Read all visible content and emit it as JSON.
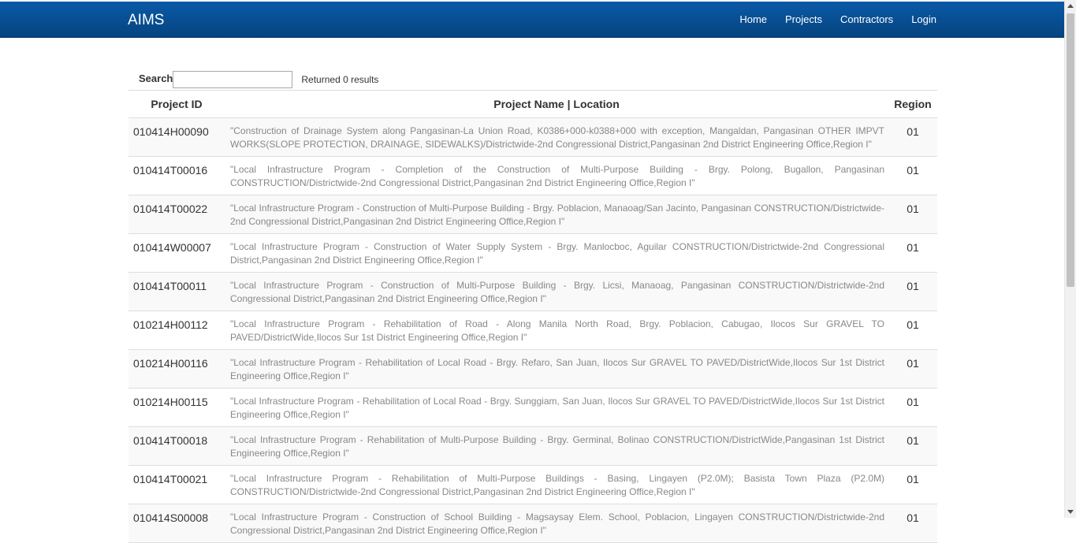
{
  "navbar": {
    "brand": "AIMS",
    "links": [
      "Home",
      "Projects",
      "Contractors",
      "Login"
    ]
  },
  "search": {
    "label": "Search",
    "value": "",
    "result_text": "Returned 0 results"
  },
  "table": {
    "headers": [
      "Project ID",
      "Project Name | Location",
      "Region"
    ],
    "rows": [
      {
        "id": "010414H00090",
        "name": "\"Construction of Drainage System along Pangasinan-La Union Road, K0386+000-k0388+000 with exception, Mangaldan, Pangasinan OTHER IMPVT WORKS(SLOPE PROTECTION, DRAINAGE, SIDEWALKS)/Districtwide-2nd Congressional District,Pangasinan 2nd District Engineering Office,Region I\"",
        "region": "01"
      },
      {
        "id": "010414T00016",
        "name": "\"Local Infrastructure Program - Completion of the Construction of Multi-Purpose Building - Brgy. Polong, Bugallon, Pangasinan CONSTRUCTION/Districtwide-2nd Congressional District,Pangasinan 2nd District Engineering Office,Region I\"",
        "region": "01"
      },
      {
        "id": "010414T00022",
        "name": "\"Local Infrastructure Program - Construction of Multi-Purpose Building - Brgy. Poblacion, Manaoag/San Jacinto, Pangasinan CONSTRUCTION/Districtwide-2nd Congressional District,Pangasinan 2nd District Engineering Office,Region I\"",
        "region": "01"
      },
      {
        "id": "010414W00007",
        "name": "\"Local Infrastructure Program - Construction of Water Supply System - Brgy. Manlocboc, Aguilar CONSTRUCTION/Districtwide-2nd Congressional District,Pangasinan 2nd District Engineering Office,Region I\"",
        "region": "01"
      },
      {
        "id": "010414T00011",
        "name": "\"Local Infrastructure Program - Construction of Multi-Purpose Building - Brgy. Licsi, Manaoag, Pangasinan CONSTRUCTION/Districtwide-2nd Congressional District,Pangasinan 2nd District Engineering Office,Region I\"",
        "region": "01"
      },
      {
        "id": "010214H00112",
        "name": "\"Local Infrastructure Program - Rehabilitation of Road - Along Manila North Road, Brgy. Poblacion, Cabugao, Ilocos Sur GRAVEL TO PAVED/DistrictWide,Ilocos Sur 1st District Engineering Office,Region I\"",
        "region": "01"
      },
      {
        "id": "010214H00116",
        "name": "\"Local Infrastructure Program - Rehabilitation of Local Road - Brgy. Refaro, San Juan, Ilocos Sur GRAVEL TO PAVED/DistrictWide,Ilocos Sur 1st District Engineering Office,Region I\"",
        "region": "01"
      },
      {
        "id": "010214H00115",
        "name": "\"Local Infrastructure Program - Rehabilitation of Local Road - Brgy. Sunggiam, San Juan, Ilocos Sur GRAVEL TO PAVED/DistrictWide,Ilocos Sur 1st District Engineering Office,Region I\"",
        "region": "01"
      },
      {
        "id": "010414T00018",
        "name": "\"Local Infrastructure Program - Rehabilitation of Multi-Purpose Building - Brgy. Germinal, Bolinao CONSTRUCTION/DistrictWide,Pangasinan 1st District Engineering Office,Region I\"",
        "region": "01"
      },
      {
        "id": "010414T00021",
        "name": "\"Local Infrastructure Program - Rehabilitation of Multi-Purpose Buildings - Basing, Lingayen (P2.0M); Basista Town Plaza (P2.0M) CONSTRUCTION/Districtwide-2nd Congressional District,Pangasinan 2nd District Engineering Office,Region I\"",
        "region": "01"
      },
      {
        "id": "010414S00008",
        "name": "\"Local Infrastructure Program - Construction of School Building - Magsaysay Elem. School, Poblacion, Lingayen CONSTRUCTION/Districtwide-2nd Congressional District,Pangasinan 2nd District Engineering Office,Region I\"",
        "region": "01"
      }
    ]
  }
}
